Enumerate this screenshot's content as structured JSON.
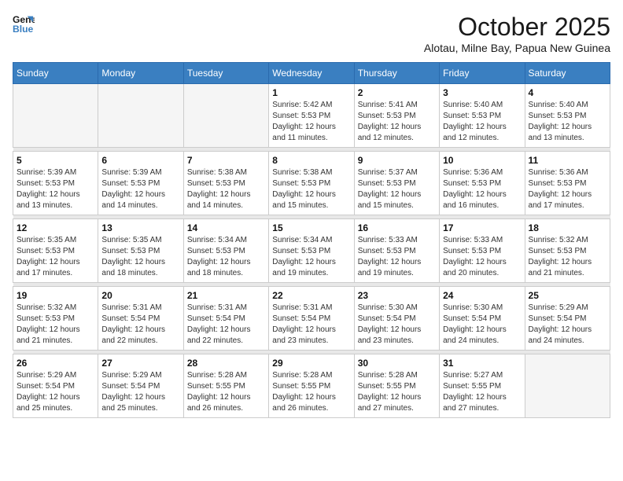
{
  "header": {
    "logo_line1": "General",
    "logo_line2": "Blue",
    "month": "October 2025",
    "location": "Alotau, Milne Bay, Papua New Guinea"
  },
  "weekdays": [
    "Sunday",
    "Monday",
    "Tuesday",
    "Wednesday",
    "Thursday",
    "Friday",
    "Saturday"
  ],
  "weeks": [
    [
      {
        "day": "",
        "info": ""
      },
      {
        "day": "",
        "info": ""
      },
      {
        "day": "",
        "info": ""
      },
      {
        "day": "1",
        "info": "Sunrise: 5:42 AM\nSunset: 5:53 PM\nDaylight: 12 hours\nand 11 minutes."
      },
      {
        "day": "2",
        "info": "Sunrise: 5:41 AM\nSunset: 5:53 PM\nDaylight: 12 hours\nand 12 minutes."
      },
      {
        "day": "3",
        "info": "Sunrise: 5:40 AM\nSunset: 5:53 PM\nDaylight: 12 hours\nand 12 minutes."
      },
      {
        "day": "4",
        "info": "Sunrise: 5:40 AM\nSunset: 5:53 PM\nDaylight: 12 hours\nand 13 minutes."
      }
    ],
    [
      {
        "day": "5",
        "info": "Sunrise: 5:39 AM\nSunset: 5:53 PM\nDaylight: 12 hours\nand 13 minutes."
      },
      {
        "day": "6",
        "info": "Sunrise: 5:39 AM\nSunset: 5:53 PM\nDaylight: 12 hours\nand 14 minutes."
      },
      {
        "day": "7",
        "info": "Sunrise: 5:38 AM\nSunset: 5:53 PM\nDaylight: 12 hours\nand 14 minutes."
      },
      {
        "day": "8",
        "info": "Sunrise: 5:38 AM\nSunset: 5:53 PM\nDaylight: 12 hours\nand 15 minutes."
      },
      {
        "day": "9",
        "info": "Sunrise: 5:37 AM\nSunset: 5:53 PM\nDaylight: 12 hours\nand 15 minutes."
      },
      {
        "day": "10",
        "info": "Sunrise: 5:36 AM\nSunset: 5:53 PM\nDaylight: 12 hours\nand 16 minutes."
      },
      {
        "day": "11",
        "info": "Sunrise: 5:36 AM\nSunset: 5:53 PM\nDaylight: 12 hours\nand 17 minutes."
      }
    ],
    [
      {
        "day": "12",
        "info": "Sunrise: 5:35 AM\nSunset: 5:53 PM\nDaylight: 12 hours\nand 17 minutes."
      },
      {
        "day": "13",
        "info": "Sunrise: 5:35 AM\nSunset: 5:53 PM\nDaylight: 12 hours\nand 18 minutes."
      },
      {
        "day": "14",
        "info": "Sunrise: 5:34 AM\nSunset: 5:53 PM\nDaylight: 12 hours\nand 18 minutes."
      },
      {
        "day": "15",
        "info": "Sunrise: 5:34 AM\nSunset: 5:53 PM\nDaylight: 12 hours\nand 19 minutes."
      },
      {
        "day": "16",
        "info": "Sunrise: 5:33 AM\nSunset: 5:53 PM\nDaylight: 12 hours\nand 19 minutes."
      },
      {
        "day": "17",
        "info": "Sunrise: 5:33 AM\nSunset: 5:53 PM\nDaylight: 12 hours\nand 20 minutes."
      },
      {
        "day": "18",
        "info": "Sunrise: 5:32 AM\nSunset: 5:53 PM\nDaylight: 12 hours\nand 21 minutes."
      }
    ],
    [
      {
        "day": "19",
        "info": "Sunrise: 5:32 AM\nSunset: 5:53 PM\nDaylight: 12 hours\nand 21 minutes."
      },
      {
        "day": "20",
        "info": "Sunrise: 5:31 AM\nSunset: 5:54 PM\nDaylight: 12 hours\nand 22 minutes."
      },
      {
        "day": "21",
        "info": "Sunrise: 5:31 AM\nSunset: 5:54 PM\nDaylight: 12 hours\nand 22 minutes."
      },
      {
        "day": "22",
        "info": "Sunrise: 5:31 AM\nSunset: 5:54 PM\nDaylight: 12 hours\nand 23 minutes."
      },
      {
        "day": "23",
        "info": "Sunrise: 5:30 AM\nSunset: 5:54 PM\nDaylight: 12 hours\nand 23 minutes."
      },
      {
        "day": "24",
        "info": "Sunrise: 5:30 AM\nSunset: 5:54 PM\nDaylight: 12 hours\nand 24 minutes."
      },
      {
        "day": "25",
        "info": "Sunrise: 5:29 AM\nSunset: 5:54 PM\nDaylight: 12 hours\nand 24 minutes."
      }
    ],
    [
      {
        "day": "26",
        "info": "Sunrise: 5:29 AM\nSunset: 5:54 PM\nDaylight: 12 hours\nand 25 minutes."
      },
      {
        "day": "27",
        "info": "Sunrise: 5:29 AM\nSunset: 5:54 PM\nDaylight: 12 hours\nand 25 minutes."
      },
      {
        "day": "28",
        "info": "Sunrise: 5:28 AM\nSunset: 5:55 PM\nDaylight: 12 hours\nand 26 minutes."
      },
      {
        "day": "29",
        "info": "Sunrise: 5:28 AM\nSunset: 5:55 PM\nDaylight: 12 hours\nand 26 minutes."
      },
      {
        "day": "30",
        "info": "Sunrise: 5:28 AM\nSunset: 5:55 PM\nDaylight: 12 hours\nand 27 minutes."
      },
      {
        "day": "31",
        "info": "Sunrise: 5:27 AM\nSunset: 5:55 PM\nDaylight: 12 hours\nand 27 minutes."
      },
      {
        "day": "",
        "info": ""
      }
    ]
  ]
}
